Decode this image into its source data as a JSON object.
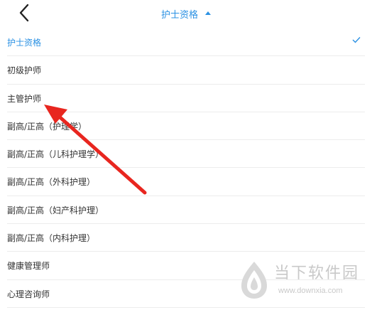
{
  "header": {
    "back_icon": "chevron-left-icon",
    "title": "护士资格",
    "title_icon": "caret-up-icon"
  },
  "list": {
    "selected_index": 0,
    "items": [
      {
        "label": "护士资格"
      },
      {
        "label": "初级护师"
      },
      {
        "label": "主管护师"
      },
      {
        "label": "副高/正高（护理学）"
      },
      {
        "label": "副高/正高（儿科护理学）"
      },
      {
        "label": "副高/正高（外科护理）"
      },
      {
        "label": "副高/正高（妇产科护理）"
      },
      {
        "label": "副高/正高（内科护理）"
      },
      {
        "label": "健康管理师"
      },
      {
        "label": "心理咨询师"
      }
    ]
  },
  "watermark": {
    "name": "当下软件园",
    "url": "www.downxia.com",
    "logo_icon": "downxia-logo-icon"
  },
  "annotation": {
    "icon": "red-arrow-icon",
    "color": "#e8261f"
  },
  "colors": {
    "accent": "#2b91e3",
    "text": "#333333",
    "divider": "#ececec"
  }
}
